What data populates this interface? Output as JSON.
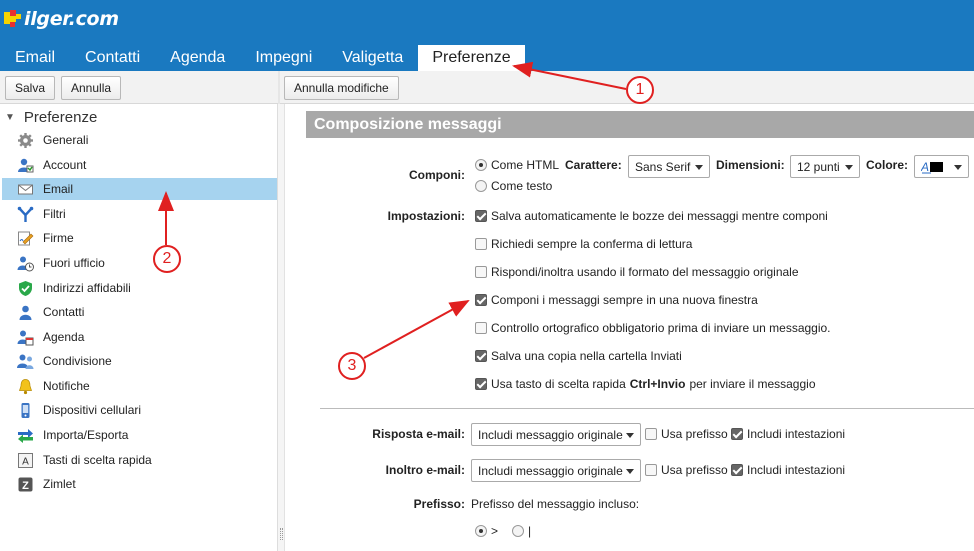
{
  "brand": {
    "logo_text": "ilger.com"
  },
  "tabs": [
    {
      "label": "Email"
    },
    {
      "label": "Contatti"
    },
    {
      "label": "Agenda"
    },
    {
      "label": "Impegni"
    },
    {
      "label": "Valigetta"
    },
    {
      "label": "Preferenze",
      "active": true
    }
  ],
  "toolbar": {
    "save_label": "Salva",
    "cancel_label": "Annulla",
    "undo_changes_label": "Annulla modifiche"
  },
  "sidebar": {
    "header": "Preferenze",
    "items": [
      {
        "label": "Generali",
        "icon": "gear-icon"
      },
      {
        "label": "Account",
        "icon": "account-icon"
      },
      {
        "label": "Email",
        "icon": "envelope-icon",
        "selected": true
      },
      {
        "label": "Filtri",
        "icon": "filter-icon"
      },
      {
        "label": "Firme",
        "icon": "signature-icon"
      },
      {
        "label": "Fuori ufficio",
        "icon": "out-of-office-icon"
      },
      {
        "label": "Indirizzi affidabili",
        "icon": "shield-icon"
      },
      {
        "label": "Contatti",
        "icon": "contact-icon"
      },
      {
        "label": "Agenda",
        "icon": "calendar-icon"
      },
      {
        "label": "Condivisione",
        "icon": "share-icon"
      },
      {
        "label": "Notifiche",
        "icon": "bell-icon"
      },
      {
        "label": "Dispositivi cellulari",
        "icon": "mobile-icon"
      },
      {
        "label": "Importa/Esporta",
        "icon": "import-export-icon"
      },
      {
        "label": "Tasti di scelta rapida",
        "icon": "keyboard-icon"
      },
      {
        "label": "Zimlet",
        "icon": "zimlet-icon"
      }
    ]
  },
  "main": {
    "section_title": "Composizione messaggi",
    "compose": {
      "label": "Componi:",
      "html_option": "Come HTML",
      "text_option": "Come testo",
      "font_label": "Carattere:",
      "font_value": "Sans Serif",
      "size_label": "Dimensioni:",
      "size_value": "12 punti",
      "color_label": "Colore:"
    },
    "settings": {
      "label": "Impostazioni:",
      "options": [
        {
          "text": "Salva automaticamente le bozze dei messaggi mentre componi",
          "checked": true
        },
        {
          "text": "Richiedi sempre la conferma di lettura",
          "checked": false
        },
        {
          "text": "Rispondi/inoltra usando il formato del messaggio originale",
          "checked": false
        },
        {
          "text": "Componi i messaggi sempre in una nuova finestra",
          "checked": true
        },
        {
          "text": "Controllo ortografico obbligatorio prima di inviare un messaggio.",
          "checked": false
        },
        {
          "text": "Salva una copia nella cartella Inviati",
          "checked": true
        }
      ],
      "shortcut_prefix": "Usa tasto di scelta rapida",
      "shortcut_keys": "Ctrl+Invio",
      "shortcut_suffix": "per inviare il messaggio",
      "shortcut_checked": true
    },
    "reply": {
      "label": "Risposta e-mail:",
      "select_value": "Includi messaggio originale",
      "use_prefix": "Usa prefisso",
      "use_prefix_checked": false,
      "include_headers": "Includi intestazioni",
      "include_headers_checked": true
    },
    "forward": {
      "label": "Inoltro e-mail:",
      "select_value": "Includi messaggio originale",
      "use_prefix": "Usa prefisso",
      "use_prefix_checked": false,
      "include_headers": "Includi intestazioni",
      "include_headers_checked": true
    },
    "prefix": {
      "label": "Prefisso:",
      "description": "Prefisso del messaggio incluso:",
      "option_gt": ">",
      "option_pipe": "|"
    }
  },
  "callouts": [
    "1",
    "2",
    "3"
  ],
  "colors": {
    "header_blue": "#1a79c0",
    "selected_row": "#a6d3ef",
    "section_bar": "#a8a8a8",
    "annotation_red": "#e02020"
  }
}
